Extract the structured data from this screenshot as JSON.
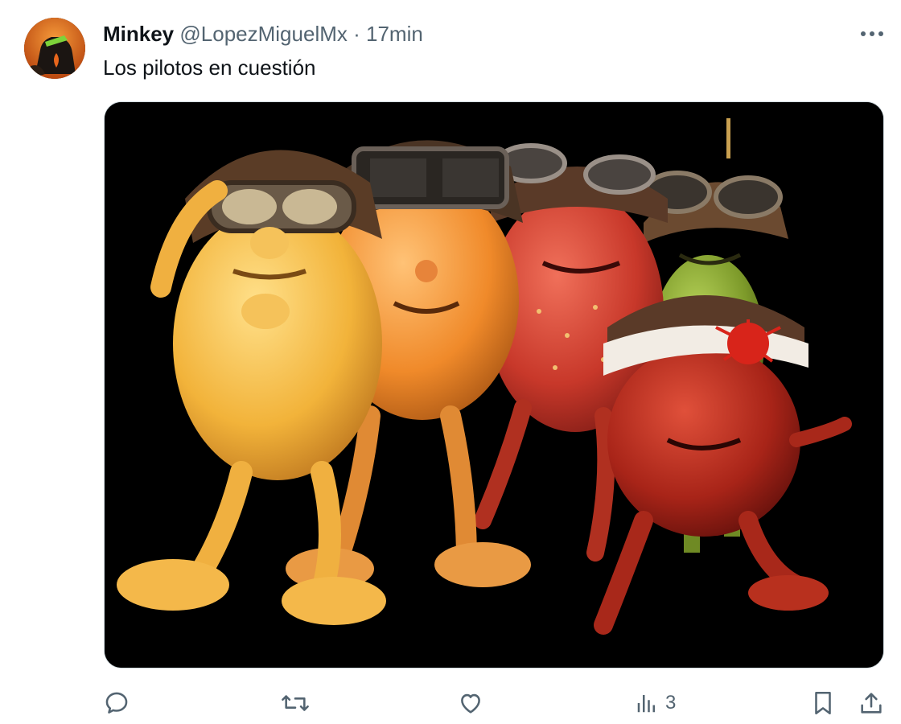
{
  "author": {
    "display_name": "Minkey",
    "handle": "@LopezMiguelMx",
    "separator": "·",
    "timestamp": "17min"
  },
  "tweet": {
    "text": "Los pilotos en cuestión"
  },
  "media": {
    "background": "#000000",
    "characters": [
      "yellow-potato-pilot",
      "orange-pilot",
      "strawberry-pilot",
      "green-pear-pilot",
      "red-tomato-pilot-headband"
    ]
  },
  "actions": {
    "reply_icon": "reply-icon",
    "retweet_icon": "retweet-icon",
    "like_icon": "heart-icon",
    "views_icon": "views-icon",
    "views_count": "3",
    "bookmark_icon": "bookmark-icon",
    "share_icon": "share-icon"
  },
  "colors": {
    "text_primary": "#0f1419",
    "text_secondary": "#536471",
    "border": "#cfd9de"
  }
}
